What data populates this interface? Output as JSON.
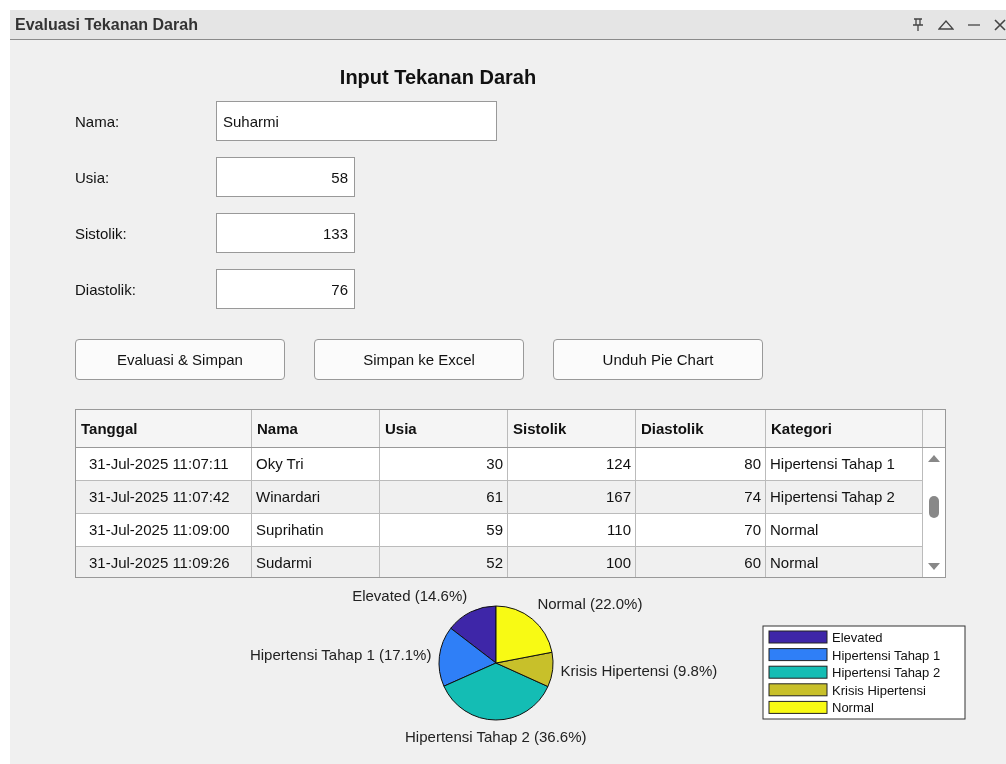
{
  "window": {
    "title": "Evaluasi Tekanan Darah"
  },
  "form": {
    "heading": "Input Tekanan Darah",
    "fields": [
      {
        "label": "Nama:",
        "value": "Suharmi",
        "kind": "text"
      },
      {
        "label": "Usia:",
        "value": "58",
        "kind": "number"
      },
      {
        "label": "Sistolik:",
        "value": "133",
        "kind": "number"
      },
      {
        "label": "Diastolik:",
        "value": "76",
        "kind": "number"
      }
    ]
  },
  "buttons": [
    "Evaluasi & Simpan",
    "Simpan ke Excel",
    "Unduh Pie Chart"
  ],
  "table": {
    "columns": [
      "Tanggal",
      "Nama",
      "Usia",
      "Sistolik",
      "Diastolik",
      "Kategori"
    ],
    "rows": [
      [
        "31-Jul-2025 11:07:11",
        "Oky Tri",
        "30",
        "124",
        "80",
        "Hipertensi Tahap 1"
      ],
      [
        "31-Jul-2025 11:07:42",
        "Winardari",
        "61",
        "167",
        "74",
        "Hipertensi Tahap 2"
      ],
      [
        "31-Jul-2025 11:09:00",
        "Suprihatin",
        "59",
        "110",
        "70",
        "Normal"
      ],
      [
        "31-Jul-2025 11:09:26",
        "Sudarmi",
        "52",
        "100",
        "60",
        "Normal"
      ]
    ]
  },
  "chart": {
    "chart_data": {
      "type": "pie",
      "categories": [
        "Elevated",
        "Hipertensi Tahap 1",
        "Hipertensi Tahap 2",
        "Krisis Hipertensi",
        "Normal"
      ],
      "values": [
        14.6,
        17.1,
        36.6,
        9.8,
        22.0
      ],
      "legend": true,
      "colors": [
        "#3e26a8",
        "#2f7ff7",
        "#14bdb4",
        "#c8c02a",
        "#f8fa14"
      ],
      "value_labels": [
        "Elevated (14.6%)",
        "Hipertensi Tahap 1 (17.1%)",
        "Hipertensi Tahap 2 (36.6%)",
        "Krisis Hipertensi (9.8%)",
        "Normal (22.0%)"
      ]
    }
  }
}
